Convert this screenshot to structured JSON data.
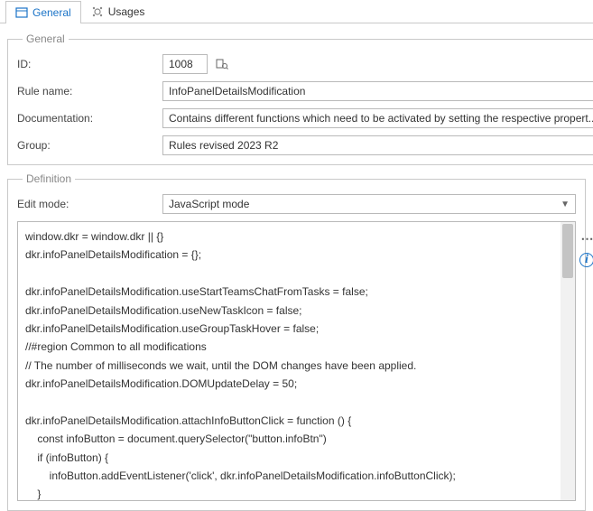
{
  "tabs": {
    "general": "General",
    "usages": "Usages"
  },
  "general": {
    "legend": "General",
    "id_label": "ID:",
    "id_value": "1008",
    "rule_label": "Rule name:",
    "rule_value": "InfoPanelDetailsModification",
    "doc_label": "Documentation:",
    "doc_value": "Contains different functions which need to be activated by setting the respective propert...",
    "group_label": "Group:",
    "group_value": "Rules revised 2023 R2"
  },
  "definition": {
    "legend": "Definition",
    "editmode_label": "Edit mode:",
    "editmode_value": "JavaScript mode",
    "code": "window.dkr = window.dkr || {}\ndkr.infoPanelDetailsModification = {};\n\ndkr.infoPanelDetailsModification.useStartTeamsChatFromTasks = false;\ndkr.infoPanelDetailsModification.useNewTaskIcon = false;\ndkr.infoPanelDetailsModification.useGroupTaskHover = false;\n//#region Common to all modifications\n// The number of milliseconds we wait, until the DOM changes have been applied.\ndkr.infoPanelDetailsModification.DOMUpdateDelay = 50;\n\ndkr.infoPanelDetailsModification.attachInfoButtonClick = function () {\n    const infoButton = document.querySelector(\"button.infoBtn\")\n    if (infoButton) {\n        infoButton.addEventListener('click', dkr.infoPanelDetailsModification.infoButtonClick);\n    }\n}"
  }
}
